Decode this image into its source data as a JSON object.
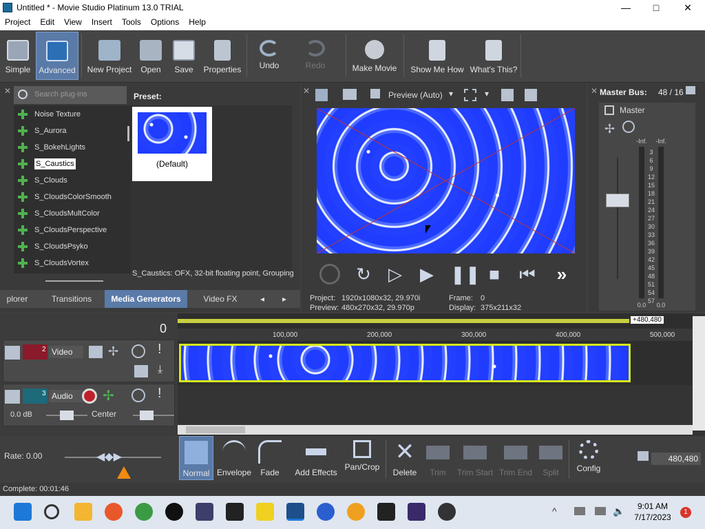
{
  "window": {
    "title": "Untitled * - Movie Studio Platinum 13.0 TRIAL",
    "min": "—",
    "max": "□",
    "close": "✕"
  },
  "menu": [
    "Project",
    "Edit",
    "View",
    "Insert",
    "Tools",
    "Options",
    "Help"
  ],
  "toolbar": {
    "simple": "Simple",
    "advanced": "Advanced",
    "new_project": "New Project",
    "open": "Open",
    "save": "Save",
    "properties": "Properties",
    "undo": "Undo",
    "redo": "Redo",
    "make_movie": "Make Movie",
    "show_me_how": "Show Me How",
    "whats_this": "What's This?"
  },
  "plugins": {
    "search_placeholder": "Search plug-ins",
    "items": [
      "Noise Texture",
      "S_Aurora",
      "S_BokehLights",
      "S_Caustics",
      "S_Clouds",
      "S_CloudsColorSmooth",
      "S_CloudsMultColor",
      "S_CloudsPerspective",
      "S_CloudsPsyko",
      "S_CloudsVortex"
    ],
    "selected": "S_Caustics",
    "preset_label": "Preset:",
    "preset_name": "(Default)",
    "status": "S_Caustics: OFX, 32-bit floating point, Grouping"
  },
  "tabs": [
    "plorer",
    "Transitions",
    "Media Generators",
    "Video FX"
  ],
  "preview": {
    "mode": "Preview (Auto)",
    "project_label": "Project:",
    "project_value": "1920x1080x32, 29.970i",
    "preview_label": "Preview:",
    "preview_value": "480x270x32, 29.970p",
    "frame_label": "Frame:",
    "frame_value": "0",
    "display_label": "Display:",
    "display_value": "375x211x32"
  },
  "master": {
    "title": "Master Bus:",
    "count": "48 / 16",
    "name": "Master",
    "scale_top": [
      "-Inf.",
      "-Inf."
    ],
    "scale": [
      "3",
      "6",
      "9",
      "12",
      "15",
      "18",
      "21",
      "24",
      "27",
      "30",
      "33",
      "36",
      "39",
      "42",
      "45",
      "48",
      "51",
      "54",
      "57"
    ],
    "scale_bottom": [
      "0.0",
      "0.0"
    ]
  },
  "timeline": {
    "position": "0",
    "end_marker": "+480,480",
    "ruler": [
      "100,000",
      "200,000",
      "300,000",
      "400,000",
      "500,000"
    ],
    "video_track": {
      "num": "2",
      "name": "Video"
    },
    "audio_track": {
      "num": "3",
      "name": "Audio",
      "volume": "0.0 dB",
      "pan": "Center"
    },
    "rate": "Rate: 0.00",
    "counter": "480,480"
  },
  "bottom_tools": {
    "normal": "Normal",
    "envelope": "Envelope",
    "fade": "Fade",
    "add_effects": "Add Effects",
    "pan_crop": "Pan/Crop",
    "delete": "Delete",
    "trim": "Trim",
    "trim_start": "Trim Start",
    "trim_end": "Trim End",
    "split": "Split",
    "config": "Config"
  },
  "status": "Complete: 00:01:46",
  "taskbar": {
    "time": "9:01 AM",
    "date": "7/17/2023",
    "badge": "1"
  },
  "colors": {
    "accent": "#5a7aa8",
    "water": "#2a45f5",
    "clip_border": "#d8e81a"
  }
}
